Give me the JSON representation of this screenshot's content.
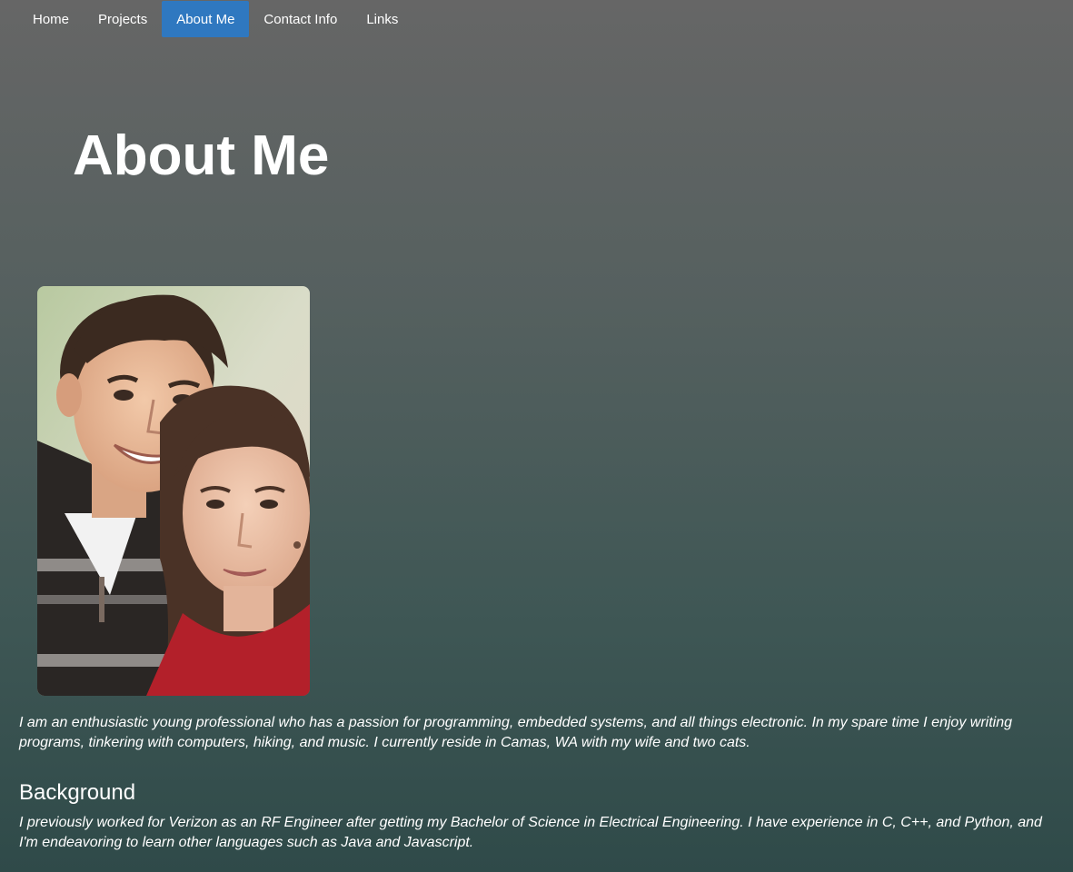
{
  "nav": {
    "items": [
      {
        "label": "Home"
      },
      {
        "label": "Projects"
      },
      {
        "label": "About Me"
      },
      {
        "label": "Contact Info"
      },
      {
        "label": "Links"
      }
    ],
    "active": "About Me",
    "active_color": "#2f78c0"
  },
  "page": {
    "title": "About Me"
  },
  "photo": {
    "subject": "couple-portrait"
  },
  "intro": {
    "text": "I am an enthusiastic young professional who has a passion for programming, embedded systems, and all things electronic. In my spare time I enjoy writing programs, tinkering with computers, hiking, and music. I currently reside in Camas, WA with my wife and two cats."
  },
  "background": {
    "heading": "Background",
    "text": "I previously worked for Verizon as an RF Engineer after getting my Bachelor of Science in Electrical Engineering. I have experience in C, C++, and Python, and I'm endeavoring to learn other languages such as Java and Javascript."
  },
  "colors": {
    "gradient_top": "#666666",
    "gradient_bottom": "#2f4a49",
    "text": "#ffffff"
  }
}
